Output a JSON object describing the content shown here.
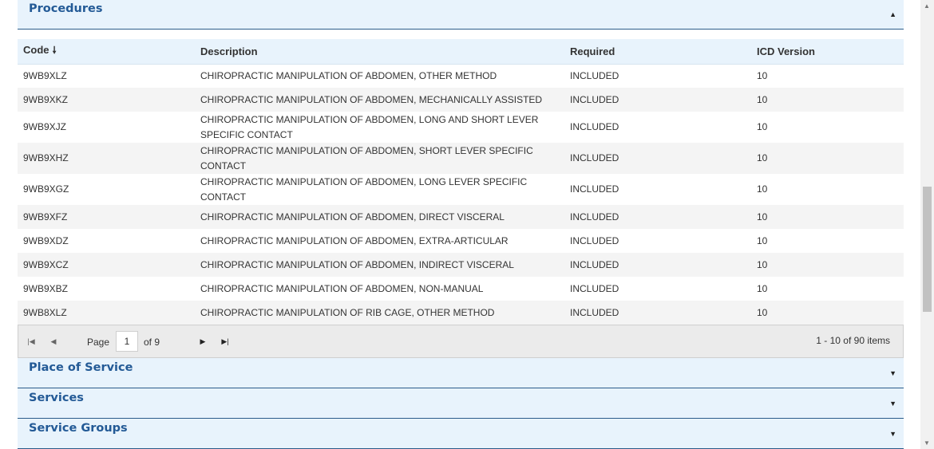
{
  "procedures_panel": {
    "title": "Procedures",
    "toggle_icon": "caret-up-icon"
  },
  "table": {
    "columns": [
      "Code",
      "Description",
      "Required",
      "ICD Version"
    ],
    "sort_icon": "arrow-down-icon",
    "rows": [
      {
        "code": "9WB9XLZ",
        "description": "CHIROPRACTIC MANIPULATION OF ABDOMEN, OTHER METHOD",
        "required": "INCLUDED",
        "icd": "10"
      },
      {
        "code": "9WB9XKZ",
        "description": "CHIROPRACTIC MANIPULATION OF ABDOMEN, MECHANICALLY ASSISTED",
        "required": "INCLUDED",
        "icd": "10"
      },
      {
        "code": "9WB9XJZ",
        "description": "CHIROPRACTIC MANIPULATION OF ABDOMEN, LONG AND SHORT LEVER SPECIFIC CONTACT",
        "required": "INCLUDED",
        "icd": "10"
      },
      {
        "code": "9WB9XHZ",
        "description": "CHIROPRACTIC MANIPULATION OF ABDOMEN, SHORT LEVER SPECIFIC CONTACT",
        "required": "INCLUDED",
        "icd": "10"
      },
      {
        "code": "9WB9XGZ",
        "description": "CHIROPRACTIC MANIPULATION OF ABDOMEN, LONG LEVER SPECIFIC CONTACT",
        "required": "INCLUDED",
        "icd": "10"
      },
      {
        "code": "9WB9XFZ",
        "description": "CHIROPRACTIC MANIPULATION OF ABDOMEN, DIRECT VISCERAL",
        "required": "INCLUDED",
        "icd": "10"
      },
      {
        "code": "9WB9XDZ",
        "description": "CHIROPRACTIC MANIPULATION OF ABDOMEN, EXTRA-ARTICULAR",
        "required": "INCLUDED",
        "icd": "10"
      },
      {
        "code": "9WB9XCZ",
        "description": "CHIROPRACTIC MANIPULATION OF ABDOMEN, INDIRECT VISCERAL",
        "required": "INCLUDED",
        "icd": "10"
      },
      {
        "code": "9WB9XBZ",
        "description": "CHIROPRACTIC MANIPULATION OF ABDOMEN, NON-MANUAL",
        "required": "INCLUDED",
        "icd": "10"
      },
      {
        "code": "9WB8XLZ",
        "description": "CHIROPRACTIC MANIPULATION OF RIB CAGE, OTHER METHOD",
        "required": "INCLUDED",
        "icd": "10"
      }
    ]
  },
  "pager": {
    "page_label": "Page",
    "page_value": "1",
    "of_label": "of 9",
    "items_info": "1 - 10 of 90 items",
    "icons": [
      "first-page-icon",
      "previous-page-icon",
      "next-page-icon",
      "last-page-icon"
    ]
  },
  "collapsed_panels": [
    {
      "title": "Place of Service",
      "toggle_icon": "caret-down-icon"
    },
    {
      "title": "Services",
      "toggle_icon": "caret-down-icon"
    },
    {
      "title": "Service Groups",
      "toggle_icon": "caret-down-icon"
    }
  ],
  "colors": {
    "panel_header_bg": "#e8f3fc",
    "panel_title": "#235a96",
    "row_alt_bg": "#f4f4f4",
    "pager_bg": "#ebebeb"
  }
}
